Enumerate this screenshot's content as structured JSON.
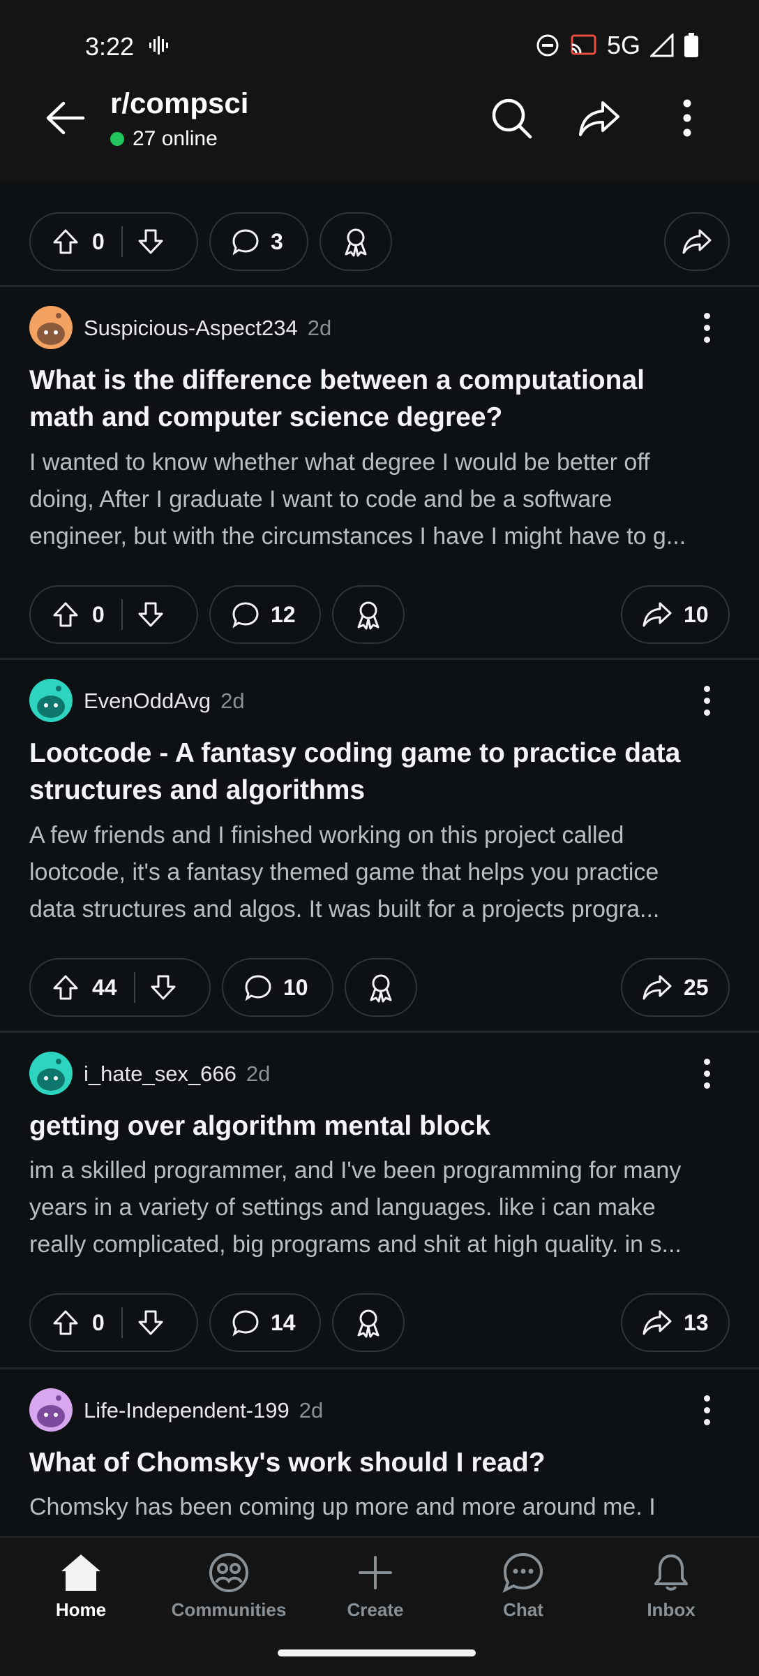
{
  "status": {
    "time": "3:22",
    "network": "5G"
  },
  "header": {
    "subreddit": "r/compsci",
    "online": "27 online"
  },
  "top_actions": {
    "score": "0",
    "comments": "3"
  },
  "posts": [
    {
      "author": "Suspicious-Aspect234",
      "age": "2d",
      "title_lines": [
        "What is the difference between a computational",
        "math and computer science degree?"
      ],
      "body_lines": [
        "I wanted to know whether what degree I would be better off",
        "doing, After I graduate I want to code and be a software",
        "engineer, but with the circumstances I have I might have to g..."
      ],
      "score": "0",
      "comments": "12",
      "shares": "10",
      "avatar_color": "#f4a261"
    },
    {
      "author": "EvenOddAvg",
      "age": "2d",
      "title_lines": [
        "Lootcode - A fantasy coding game to practice data",
        "structures and algorithms"
      ],
      "body_lines": [
        "A few friends and I finished working on this project called",
        "lootcode, it's a fantasy themed game that helps you practice",
        "data structures and algos. It was built for a projects progra..."
      ],
      "score": "44",
      "comments": "10",
      "shares": "25",
      "avatar_color": "#2dd4bf"
    },
    {
      "author": "i_hate_sex_666",
      "age": "2d",
      "title_lines": [
        "getting over algorithm mental block"
      ],
      "body_lines": [
        "im a skilled programmer, and I've been programming for many",
        "years in a variety of settings and languages. like i can make",
        "really complicated, big programs and shit at high quality. in s..."
      ],
      "score": "0",
      "comments": "14",
      "shares": "13",
      "avatar_color": "#2dd4bf"
    },
    {
      "author": "Life-Independent-199",
      "age": "2d",
      "title_lines": [
        "What of Chomsky's work should I read?"
      ],
      "body_lines": [
        "Chomsky has been coming up more and more around me. I"
      ],
      "avatar_color": "#d8a7f0"
    }
  ],
  "nav": [
    {
      "label": "Home",
      "icon": "home-icon",
      "active": true
    },
    {
      "label": "Communities",
      "icon": "communities-icon"
    },
    {
      "label": "Create",
      "icon": "plus-icon"
    },
    {
      "label": "Chat",
      "icon": "chat-icon"
    },
    {
      "label": "Inbox",
      "icon": "bell-icon"
    }
  ]
}
